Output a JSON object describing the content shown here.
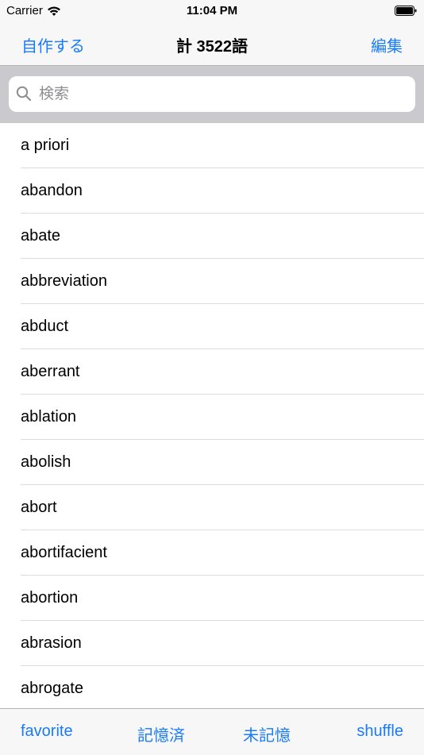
{
  "status_bar": {
    "carrier": "Carrier",
    "time": "11:04 PM"
  },
  "nav": {
    "left_label": "自作する",
    "title": "計 3522語",
    "right_label": "編集"
  },
  "search": {
    "placeholder": "検索",
    "value": ""
  },
  "words": [
    {
      "label": "a priori"
    },
    {
      "label": "abandon"
    },
    {
      "label": "abate"
    },
    {
      "label": "abbreviation"
    },
    {
      "label": "abduct"
    },
    {
      "label": "aberrant"
    },
    {
      "label": "ablation"
    },
    {
      "label": "abolish"
    },
    {
      "label": "abort"
    },
    {
      "label": "abortifacient"
    },
    {
      "label": "abortion"
    },
    {
      "label": "abrasion"
    },
    {
      "label": "abrogate"
    }
  ],
  "toolbar": {
    "favorite": "favorite",
    "memorized": "記憶済",
    "unmemorized": "未記憶",
    "shuffle": "shuffle"
  },
  "colors": {
    "accent": "#1a7cf5",
    "bar_background": "#f7f7f7",
    "search_background": "#c9c9ce",
    "separator": "#dcdcdf"
  },
  "icons": [
    "wifi-icon",
    "battery-icon",
    "search-icon"
  ]
}
